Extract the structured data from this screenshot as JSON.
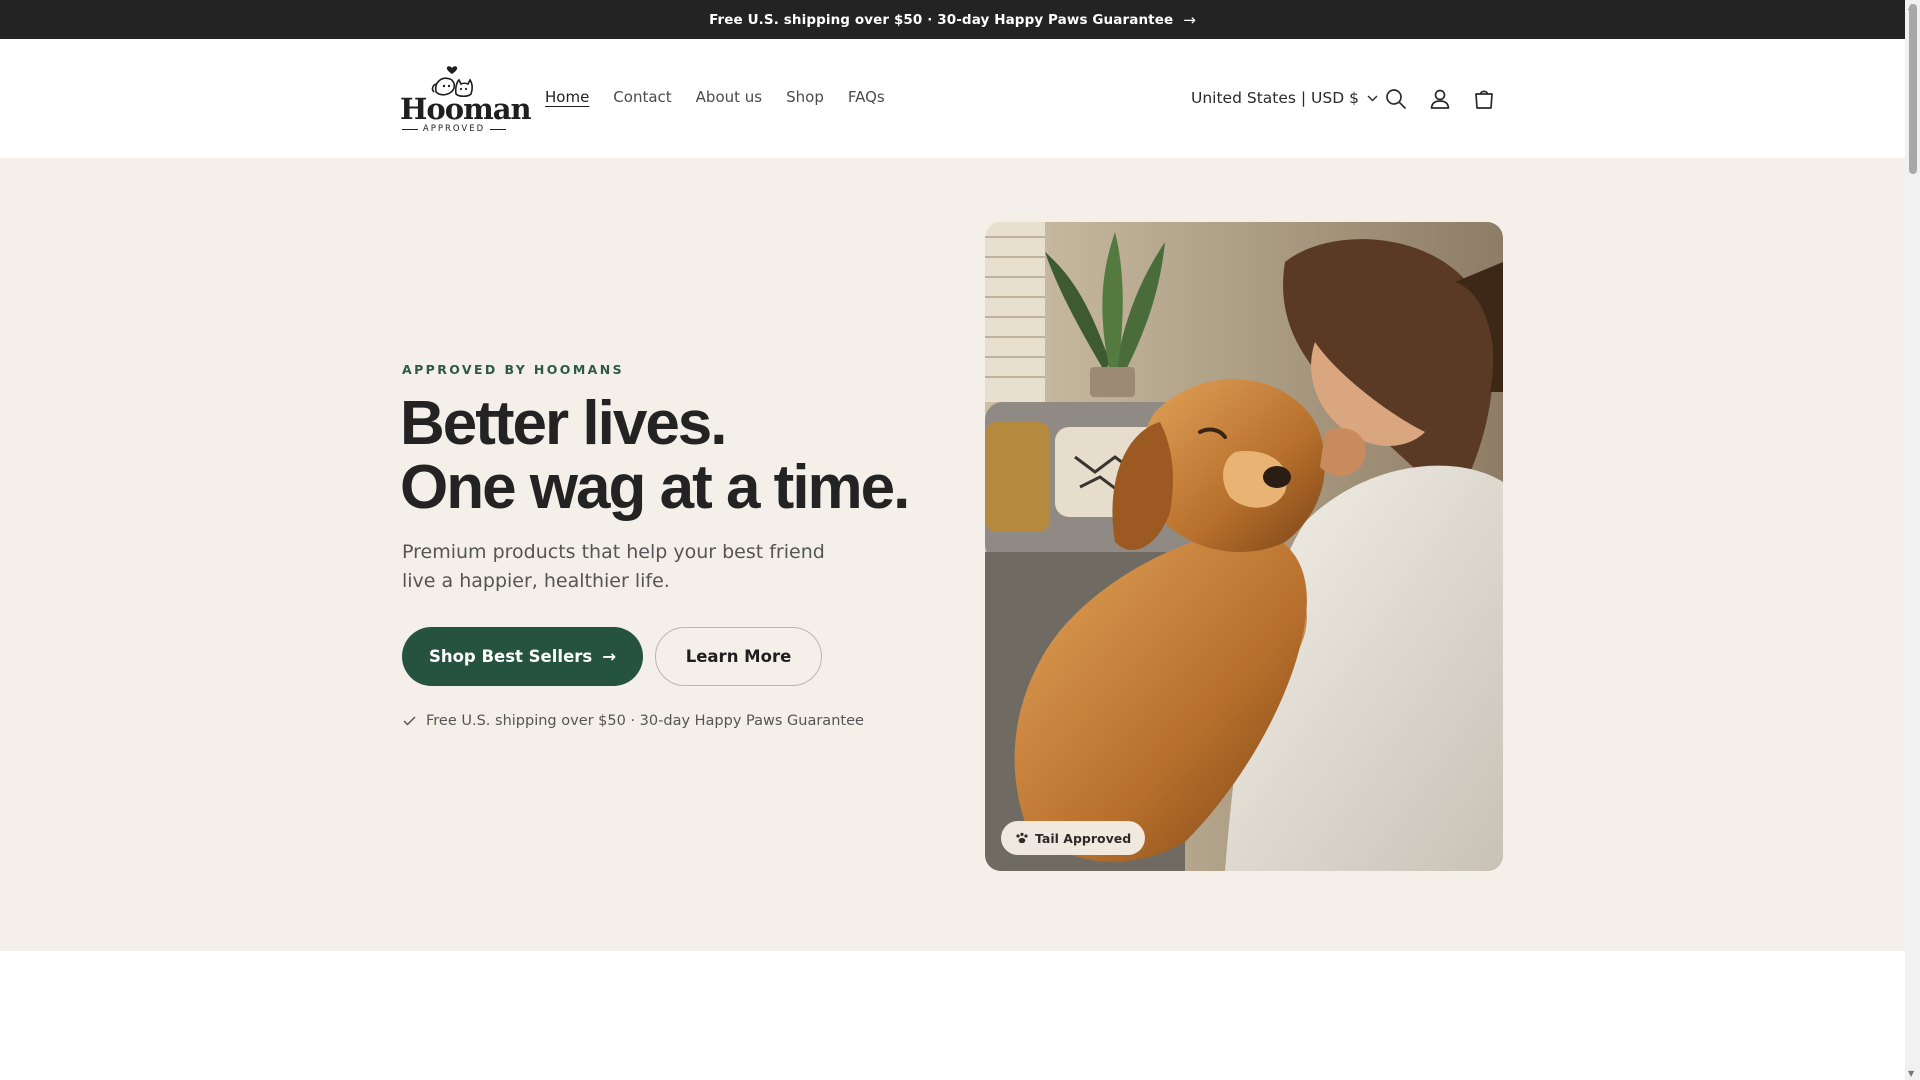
{
  "announcement": {
    "text": "Free U.S. shipping over $50 · 30-day Happy Paws Guarantee",
    "arrow": "→"
  },
  "header": {
    "logo_text": "Hooman",
    "logo_subtext": "APPROVED",
    "nav": [
      {
        "label": "Home",
        "active": true
      },
      {
        "label": "Contact",
        "active": false
      },
      {
        "label": "About us",
        "active": false
      },
      {
        "label": "Shop",
        "active": false
      },
      {
        "label": "FAQs",
        "active": false
      }
    ],
    "country_selector": "United States | USD $",
    "icons": [
      "search-icon",
      "account-icon",
      "cart-icon"
    ]
  },
  "hero": {
    "eyebrow": "APPROVED BY HOOMANS",
    "headline_line1": "Better lives.",
    "headline_line2": "One wag at a time.",
    "subheadline": "Premium products that help your best friend live a happier, healthier life.",
    "primary_button": "Shop Best Sellers",
    "primary_button_arrow": "→",
    "secondary_button": "Learn More",
    "assurance_text": "Free U.S. shipping over $50 · 30-day Happy Paws Guarantee",
    "image_badge": "Tail Approved"
  },
  "colors": {
    "announcement_bg": "#232323",
    "hero_bg": "#f4efe8",
    "brand_green": "#265340",
    "eyebrow_green": "#2e5a45"
  }
}
